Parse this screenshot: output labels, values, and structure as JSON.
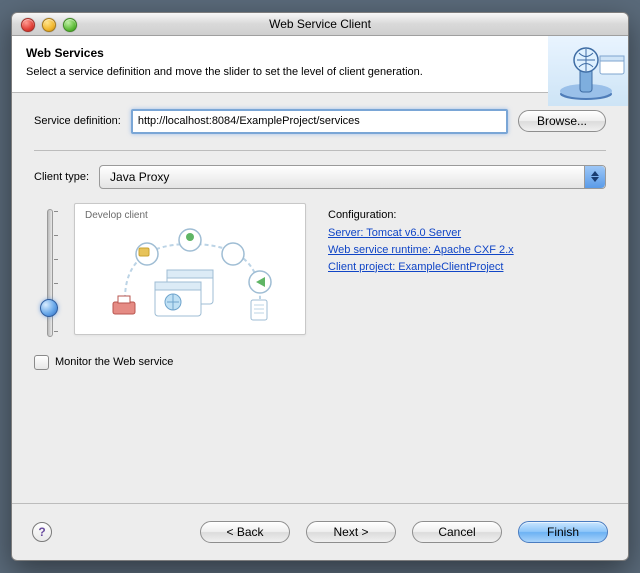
{
  "window": {
    "title": "Web Service Client"
  },
  "banner": {
    "heading": "Web Services",
    "subtext": "Select a service definition and move the slider to set the level of client generation."
  },
  "service": {
    "label": "Service definition:",
    "value": "http://localhost:8084/ExampleProject/services",
    "browse": "Browse..."
  },
  "client_type": {
    "label": "Client type:",
    "value": "Java Proxy"
  },
  "slider": {
    "level_label": "Develop client"
  },
  "config": {
    "header": "Configuration:",
    "server": "Server: Tomcat v6.0 Server",
    "runtime": "Web service runtime: Apache CXF 2.x",
    "project": "Client project: ExampleClientProject"
  },
  "monitor": {
    "label": "Monitor the Web service",
    "checked": false
  },
  "buttons": {
    "help": "?",
    "back": "< Back",
    "next": "Next >",
    "cancel": "Cancel",
    "finish": "Finish"
  }
}
